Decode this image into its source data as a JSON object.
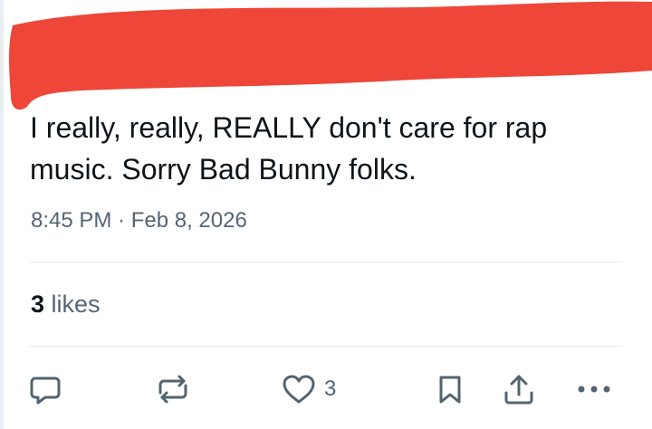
{
  "post": {
    "text": "I really, really, REALLY don't care for rap music. Sorry Bad Bunny folks.",
    "timestamp": "8:45 PM · Feb 8, 2026"
  },
  "stats": {
    "likes_count": "3",
    "likes_label": "likes"
  },
  "actions": {
    "reply_icon": "reply-icon",
    "repost_icon": "repost-icon",
    "like_icon": "heart-icon",
    "like_count": "3",
    "bookmark_icon": "bookmark-icon",
    "share_icon": "share-icon",
    "more_icon": "more-icon"
  },
  "colors": {
    "text": "#0f1419",
    "secondary_text": "#566573",
    "icon": "#536471",
    "divider": "#e4e9ec",
    "redaction": "#ee4638"
  }
}
